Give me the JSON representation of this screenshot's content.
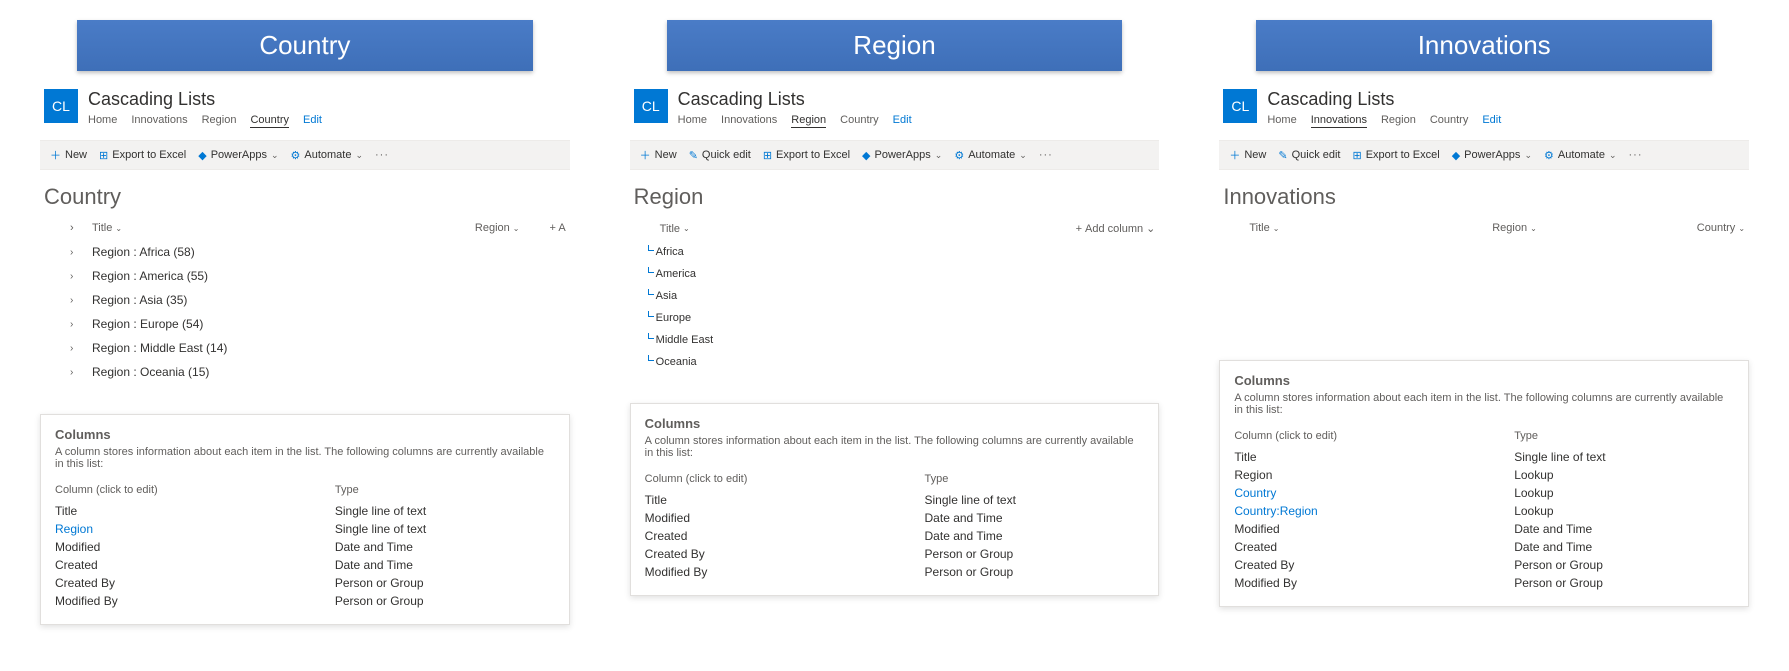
{
  "site": {
    "icon": "CL",
    "title": "Cascading Lists"
  },
  "nav": {
    "home": "Home",
    "innovations": "Innovations",
    "region": "Region",
    "country": "Country",
    "edit": "Edit"
  },
  "cmd": {
    "new": "New",
    "quickedit": "Quick edit",
    "export": "Export to Excel",
    "powerapps": "PowerApps",
    "automate": "Automate"
  },
  "col_header": {
    "title": "Title",
    "region": "Region",
    "country": "Country",
    "addcol": "Add column"
  },
  "panels": {
    "country": {
      "banner": "Country",
      "page_title": "Country",
      "groups": [
        "Region : Africa (58)",
        "Region : America (55)",
        "Region : Asia (35)",
        "Region : Europe (54)",
        "Region : Middle East (14)",
        "Region : Oceania (15)"
      ],
      "columns_card": {
        "heading": "Columns",
        "desc": "A column stores information about each item in the list. The following columns are currently available in this list:",
        "col_hdr": "Column (click to edit)",
        "type_hdr": "Type",
        "rows": [
          {
            "name": "Title",
            "type": "Single line of text",
            "link": false
          },
          {
            "name": "Region",
            "type": "Single line of text",
            "link": true
          },
          {
            "name": "Modified",
            "type": "Date and Time",
            "link": false
          },
          {
            "name": "Created",
            "type": "Date and Time",
            "link": false
          },
          {
            "name": "Created By",
            "type": "Person or Group",
            "link": false
          },
          {
            "name": "Modified By",
            "type": "Person or Group",
            "link": false
          }
        ]
      }
    },
    "region": {
      "banner": "Region",
      "page_title": "Region",
      "items": [
        "Africa",
        "America",
        "Asia",
        "Europe",
        "Middle East",
        "Oceania"
      ],
      "columns_card": {
        "heading": "Columns",
        "desc": "A column stores information about each item in the list. The following columns are currently available in this list:",
        "col_hdr": "Column (click to edit)",
        "type_hdr": "Type",
        "rows": [
          {
            "name": "Title",
            "type": "Single line of text",
            "link": false
          },
          {
            "name": "Modified",
            "type": "Date and Time",
            "link": false
          },
          {
            "name": "Created",
            "type": "Date and Time",
            "link": false
          },
          {
            "name": "Created By",
            "type": "Person or Group",
            "link": false
          },
          {
            "name": "Modified By",
            "type": "Person or Group",
            "link": false
          }
        ]
      }
    },
    "innovations": {
      "banner": "Innovations",
      "page_title": "Innovations",
      "columns_card": {
        "heading": "Columns",
        "desc": "A column stores information about each item in the list. The following columns are currently available in this list:",
        "col_hdr": "Column (click to edit)",
        "type_hdr": "Type",
        "rows": [
          {
            "name": "Title",
            "type": "Single line of text",
            "link": false
          },
          {
            "name": "Region",
            "type": "Lookup",
            "link": false
          },
          {
            "name": "Country",
            "type": "Lookup",
            "link": true
          },
          {
            "name": "Country:Region",
            "type": "Lookup",
            "link": true
          },
          {
            "name": "Modified",
            "type": "Date and Time",
            "link": false
          },
          {
            "name": "Created",
            "type": "Date and Time",
            "link": false
          },
          {
            "name": "Created By",
            "type": "Person or Group",
            "link": false
          },
          {
            "name": "Modified By",
            "type": "Person or Group",
            "link": false
          }
        ]
      }
    }
  }
}
